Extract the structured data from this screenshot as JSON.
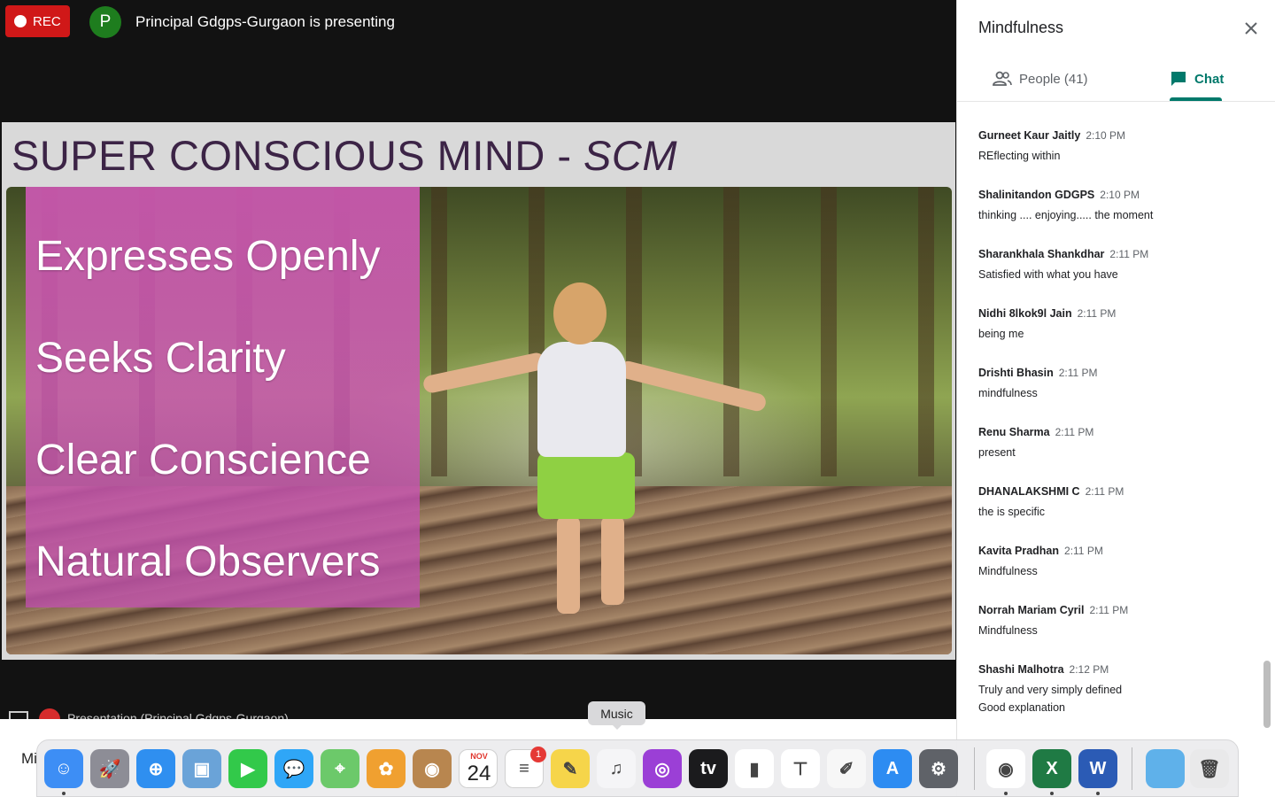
{
  "meeting": {
    "rec_label": "REC",
    "presenter_initial": "P",
    "presenter_text": "Principal Gdgps-Gurgaon is presenting",
    "bottom_strip_text": "Presentation (Principal Gdgps-Gurgaon)",
    "meeting_label": "Mi"
  },
  "slide": {
    "title_main": "SUPER CONSCIOUS MIND - ",
    "title_italic": "SCM",
    "bullets": [
      "Expresses Openly",
      "Seeks Clarity",
      "Clear Conscience",
      "Natural Observers"
    ]
  },
  "panel": {
    "title": "Mindfulness",
    "tabs": {
      "people": "People (41)",
      "chat": "Chat"
    },
    "messages": [
      {
        "sender": "Gurneet Kaur Jaitly",
        "time": "2:10 PM",
        "lines": [
          "REflecting within"
        ]
      },
      {
        "sender": "Shalinitandon GDGPS",
        "time": "2:10 PM",
        "lines": [
          "thinking .... enjoying..... the moment"
        ]
      },
      {
        "sender": "Sharankhala Shankdhar",
        "time": "2:11 PM",
        "lines": [
          "Satisfied with what you have"
        ]
      },
      {
        "sender": "Nidhi 8lkok9l Jain",
        "time": "2:11 PM",
        "lines": [
          "being me"
        ]
      },
      {
        "sender": "Drishti Bhasin",
        "time": "2:11 PM",
        "lines": [
          "mindfulness"
        ]
      },
      {
        "sender": "Renu Sharma",
        "time": "2:11 PM",
        "lines": [
          "present"
        ]
      },
      {
        "sender": "DHANALAKSHMI C",
        "time": "2:11 PM",
        "lines": [
          "the is specific"
        ]
      },
      {
        "sender": "Kavita Pradhan",
        "time": "2:11 PM",
        "lines": [
          "Mindfulness"
        ]
      },
      {
        "sender": "Norrah Mariam Cyril",
        "time": "2:11 PM",
        "lines": [
          "Mindfulness"
        ]
      },
      {
        "sender": "Shashi Malhotra",
        "time": "2:12 PM",
        "lines": [
          "Truly and very simply defined",
          "Good explanation"
        ]
      }
    ]
  },
  "dock": {
    "tooltip": "Music",
    "calendar_month": "NOV",
    "calendar_day": "24",
    "reminders_badge": "1",
    "apps": [
      {
        "name": "finder-icon",
        "color": "#3d8ef5",
        "glyph": "☺",
        "running": true
      },
      {
        "name": "launchpad-icon",
        "color": "#8d8d96",
        "glyph": "🚀",
        "running": false
      },
      {
        "name": "safari-icon",
        "color": "#2f8ff0",
        "glyph": "⊕",
        "running": false
      },
      {
        "name": "preview-icon",
        "color": "#6aa3d8",
        "glyph": "▣",
        "running": false
      },
      {
        "name": "facetime-icon",
        "color": "#32c94a",
        "glyph": "▶",
        "running": false
      },
      {
        "name": "messages-icon",
        "color": "#2fa6f7",
        "glyph": "💬",
        "running": false
      },
      {
        "name": "maps-icon",
        "color": "#6cc96a",
        "glyph": "⌖",
        "running": false
      },
      {
        "name": "photos-icon",
        "color": "#f0a030",
        "glyph": "✿",
        "running": false
      },
      {
        "name": "contacts-icon",
        "color": "#b8864f",
        "glyph": "◉",
        "running": false
      },
      {
        "name": "calendar-icon",
        "color": "#ffffff",
        "glyph": "",
        "running": false
      },
      {
        "name": "reminders-icon",
        "color": "#ffffff",
        "glyph": "≡",
        "running": false
      },
      {
        "name": "notes-icon",
        "color": "#f6d54a",
        "glyph": "✎",
        "running": false
      },
      {
        "name": "music-icon",
        "color": "#f5f5f7",
        "glyph": "♫",
        "running": false
      },
      {
        "name": "podcasts-icon",
        "color": "#9b3fd6",
        "glyph": "◎",
        "running": false
      },
      {
        "name": "apple-tv-icon",
        "color": "#1b1b1d",
        "glyph": "tv",
        "running": false
      },
      {
        "name": "numbers-icon",
        "color": "#ffffff",
        "glyph": "▮",
        "running": false
      },
      {
        "name": "keynote-icon",
        "color": "#ffffff",
        "glyph": "⊤",
        "running": false
      },
      {
        "name": "pages-icon",
        "color": "#f7f7f7",
        "glyph": "✐",
        "running": false
      },
      {
        "name": "app-store-icon",
        "color": "#2d8cf2",
        "glyph": "A",
        "running": false
      },
      {
        "name": "system-preferences-icon",
        "color": "#5f6268",
        "glyph": "⚙",
        "running": false
      },
      {
        "name": "chrome-icon",
        "color": "#ffffff",
        "glyph": "◉",
        "running": true
      },
      {
        "name": "excel-icon",
        "color": "#1f7a44",
        "glyph": "X",
        "running": true
      },
      {
        "name": "word-icon",
        "color": "#2b5bb5",
        "glyph": "W",
        "running": true
      },
      {
        "name": "folder-icon",
        "color": "#5fb1ea",
        "glyph": "",
        "running": false
      },
      {
        "name": "trash-icon",
        "color": "#e9e9ea",
        "glyph": "🗑",
        "running": false
      }
    ]
  }
}
